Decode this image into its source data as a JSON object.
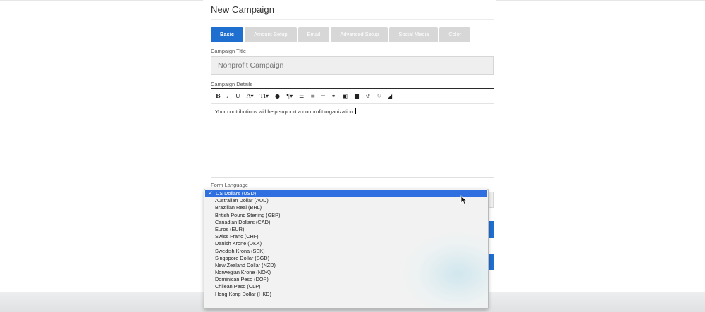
{
  "page": {
    "title": "New Campaign"
  },
  "tabs": [
    {
      "label": "Basic",
      "active": true
    },
    {
      "label": "Amount Setup",
      "active": false
    },
    {
      "label": "Email",
      "active": false
    },
    {
      "label": "Advanced Setup",
      "active": false
    },
    {
      "label": "Social Media",
      "active": false
    },
    {
      "label": "Color",
      "active": false
    }
  ],
  "campaign_title": {
    "label": "Campaign Title",
    "value": "Nonprofit Campaign"
  },
  "campaign_details": {
    "label": "Campaign Details",
    "text": "Your contributions will help support a nonprofit organization.",
    "toolbar": [
      "bold-icon",
      "italic-icon",
      "underline-icon",
      "font-size-icon",
      "text-height-icon",
      "color-icon",
      "paragraph-icon",
      "ordered-list-icon",
      "unordered-list-icon",
      "horizontal-rule-icon",
      "link-icon",
      "image-icon",
      "video-icon",
      "undo-icon",
      "redo-icon",
      "eraser-icon"
    ]
  },
  "form_language": {
    "label": "Form Language"
  },
  "currency_dropdown": {
    "selected": "US Dollars (USD)",
    "options": [
      "US Dollars (USD)",
      "Australian Dollar (AUD)",
      "Brazilian Real (BRL)",
      "British Pound Sterling (GBP)",
      "Canadian Dollars (CAD)",
      "Euros (EUR)",
      "Swiss Franc (CHF)",
      "Danish Krone (DKK)",
      "Swedish Krona (SEK)",
      "Singapore Dollar (SGD)",
      "New Zealand Dollar (NZD)",
      "Norwegian Krone (NOK)",
      "Dominican Peso (DOP)",
      "Chilean Peso (CLP)",
      "Hong Kong Dollar (HKD)"
    ]
  },
  "colors": {
    "accent": "#1f6fd1",
    "selection": "#2f6fe0",
    "tab_inactive": "#d7d7d7"
  }
}
